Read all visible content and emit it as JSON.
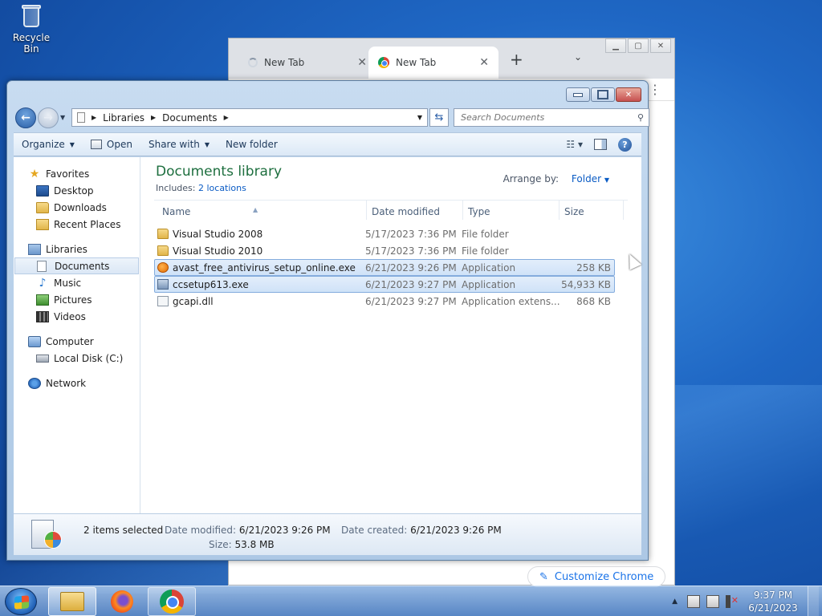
{
  "desktop": {
    "recycle_bin_label": "Recycle Bin"
  },
  "chrome": {
    "tabs": [
      {
        "title": "New Tab",
        "loading": true
      },
      {
        "title": "New Tab",
        "loading": false
      }
    ],
    "customize_label": "Customize Chrome"
  },
  "explorer": {
    "address": {
      "crumbs": [
        "Libraries",
        "Documents"
      ]
    },
    "search": {
      "placeholder": "Search Documents"
    },
    "commands": {
      "organize": "Organize",
      "open": "Open",
      "share_with": "Share with",
      "new_folder": "New folder"
    },
    "nav": {
      "favorites": "Favorites",
      "desktop": "Desktop",
      "downloads": "Downloads",
      "recent_places": "Recent Places",
      "libraries": "Libraries",
      "documents": "Documents",
      "music": "Music",
      "pictures": "Pictures",
      "videos": "Videos",
      "computer": "Computer",
      "local_disk": "Local Disk (C:)",
      "network": "Network"
    },
    "library": {
      "title": "Documents library",
      "includes_label": "Includes:",
      "includes_link": "2 locations",
      "arrange_label": "Arrange by:",
      "arrange_value": "Folder"
    },
    "columns": {
      "name": "Name",
      "date": "Date modified",
      "type": "Type",
      "size": "Size"
    },
    "files": [
      {
        "name": "Visual Studio 2008",
        "date": "5/17/2023 7:36 PM",
        "type": "File folder",
        "size": "",
        "icon": "folder-icon",
        "selected": false
      },
      {
        "name": "Visual Studio 2010",
        "date": "5/17/2023 7:36 PM",
        "type": "File folder",
        "size": "",
        "icon": "folder-icon",
        "selected": false
      },
      {
        "name": "avast_free_antivirus_setup_online.exe",
        "date": "6/21/2023 9:26 PM",
        "type": "Application",
        "size": "258 KB",
        "icon": "avast-icon",
        "selected": true
      },
      {
        "name": "ccsetup613.exe",
        "date": "6/21/2023 9:27 PM",
        "type": "Application",
        "size": "54,933 KB",
        "icon": "setup-icon",
        "selected": true
      },
      {
        "name": "gcapi.dll",
        "date": "6/21/2023 9:27 PM",
        "type": "Application extens...",
        "size": "868 KB",
        "icon": "dll-icon",
        "selected": false
      }
    ],
    "details": {
      "selection": "2 items selected",
      "date_modified_label": "Date modified:",
      "date_modified": "6/21/2023 9:26 PM",
      "date_created_label": "Date created:",
      "date_created": "6/21/2023 9:26 PM",
      "size_label": "Size:",
      "size": "53.8 MB"
    }
  },
  "taskbar": {
    "time": "9:37 PM",
    "date": "6/21/2023"
  }
}
